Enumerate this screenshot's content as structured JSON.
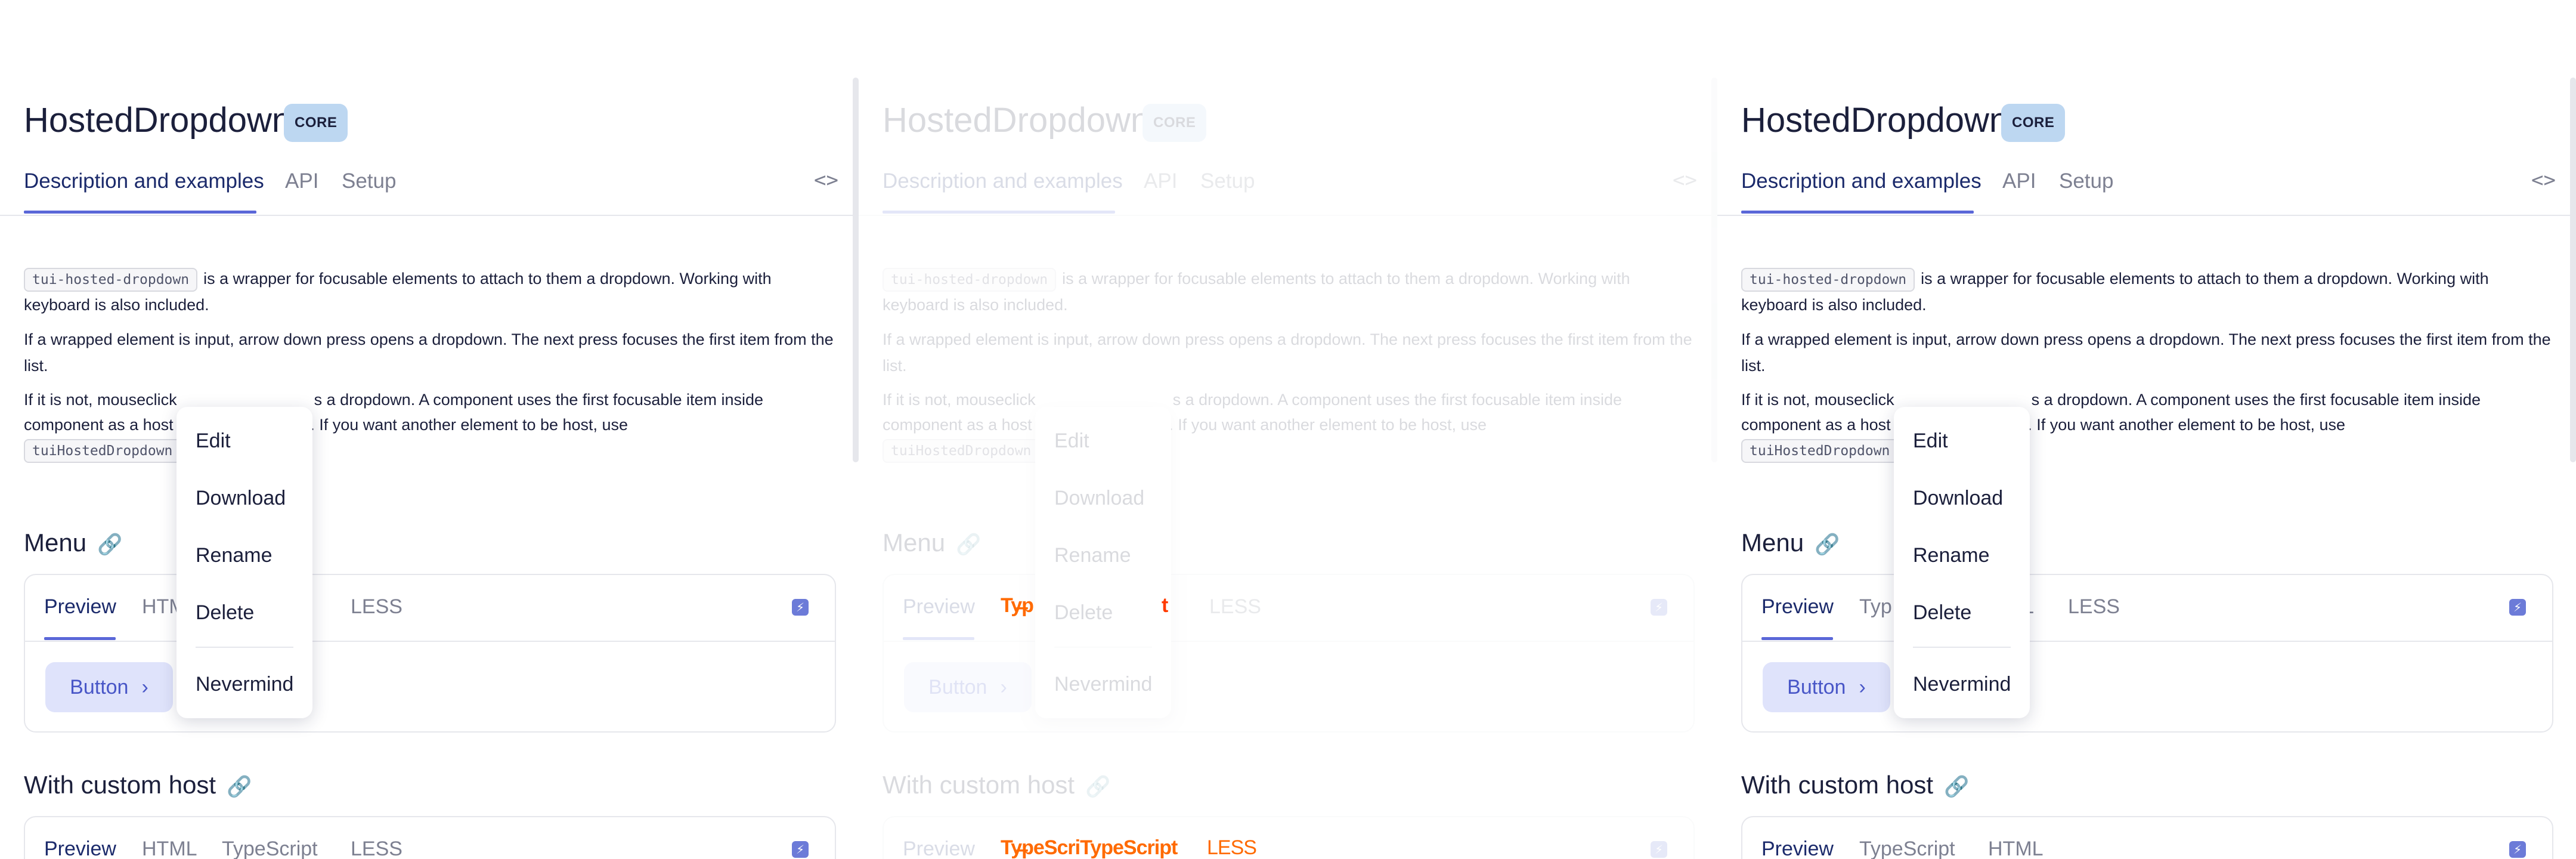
{
  "title": "HostedDropdown",
  "badge": "CORE",
  "tabs": [
    "Description and examples",
    "API",
    "Setup"
  ],
  "code_toggle_icon": "code-brackets-icon",
  "description": {
    "p1_code": "tui-hosted-dropdown",
    "p1_text": "is a wrapper for focusable elements to attach to them a dropdown. Working with keyboard is also included.",
    "p2": "If a wrapped element is input, arrow down press opens a dropdown. The next press focuses the first item from the list.",
    "p3_a": "If it is not, mouseclick",
    "p3_b": "s a dropdown. A component uses the first focusable item inside",
    "p3_c": "component as a host",
    "p3_d": "pdown. If you want another element to be host, use",
    "p3_code": "tuiHostedDropdown"
  },
  "sections": {
    "menu": {
      "title": "Menu",
      "tabs_left": [
        "Preview",
        "HTM",
        "t",
        "LESS"
      ],
      "tabs_right": [
        "Preview",
        "Typ",
        "L",
        "LESS"
      ],
      "button_label": "Button"
    },
    "custom_host": {
      "title": "With custom host",
      "tabs_left": [
        "Preview",
        "HTML",
        "TypeScript",
        "LESS"
      ],
      "tabs_right": [
        "Preview",
        "TypeScript",
        "HTML"
      ]
    }
  },
  "dropdown_items": [
    "Edit",
    "Download",
    "Rename",
    "Delete",
    "Nevermind"
  ],
  "glitch": {
    "menu_text": "Ty̶p",
    "menu_text_right": "t",
    "custom_text": "Ty̶peScriTypeScript",
    "custom_less": "LESS"
  },
  "colors": {
    "accent": "#5a67d8",
    "badge_bg": "#bdd7f1",
    "text": "#1b1f3b",
    "muted": "#7d8091",
    "glitch": "#ff6a00"
  }
}
